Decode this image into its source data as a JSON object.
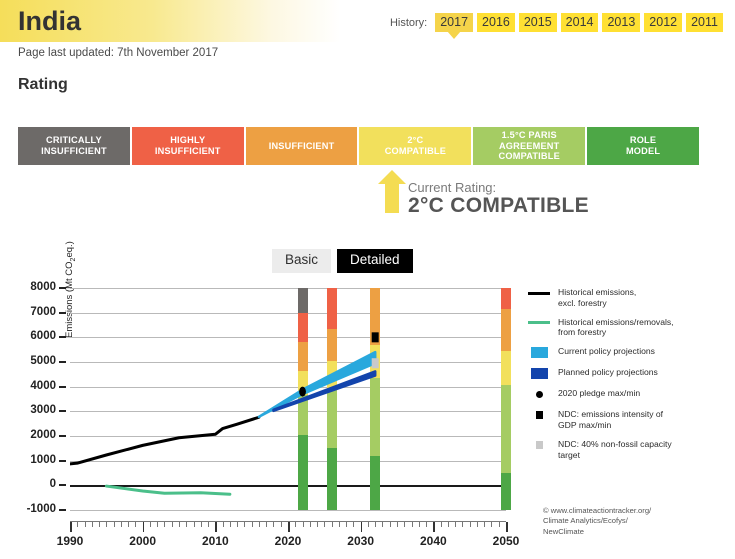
{
  "header": {
    "country_title": "India",
    "page_updated": "Page last updated: 7th November 2017",
    "history_label": "History:",
    "history_years": [
      {
        "year": "2017",
        "active": true
      },
      {
        "year": "2016",
        "active": false
      },
      {
        "year": "2015",
        "active": false
      },
      {
        "year": "2014",
        "active": false
      },
      {
        "year": "2013",
        "active": false
      },
      {
        "year": "2012",
        "active": false
      },
      {
        "year": "2011",
        "active": false
      }
    ]
  },
  "rating": {
    "heading": "Rating",
    "cells": [
      {
        "label": "CRITICALLY\nINSUFFICIENT",
        "color": "#6d6a68"
      },
      {
        "label": "HIGHLY\nINSUFFICIENT",
        "color": "#ef6146"
      },
      {
        "label": "INSUFFICIENT",
        "color": "#eda043"
      },
      {
        "label": "2°C\nCOMPATIBLE",
        "color": "#f2e05c"
      },
      {
        "label": "1.5°C PARIS\nAGREEMENT\nCOMPATIBLE",
        "color": "#a5cc63"
      },
      {
        "label": "ROLE\nMODEL",
        "color": "#4da746"
      }
    ],
    "current_label": "Current Rating:",
    "current_value": "2°C COMPATIBLE",
    "arrow_color": "#f4dc52"
  },
  "toggle": {
    "basic_label": "Basic",
    "detailed_label": "Detailed",
    "active": "Detailed"
  },
  "chart_data": {
    "type": "line",
    "title": "",
    "xlabel": "",
    "ylabel": "Emissions (Mt CO2eq.)",
    "ylabel_prefix": "Emissions (Mt CO",
    "ylabel_sub": "2",
    "ylabel_suffix": "eq.)",
    "xlim": [
      1990,
      2050
    ],
    "ylim": [
      -1000,
      8000
    ],
    "ytick_values": [
      8000,
      7000,
      6000,
      5000,
      4000,
      3000,
      2000,
      1000,
      0,
      -1000
    ],
    "ytick_labels": [
      "8000",
      "7000",
      "6000",
      "5000",
      "4000",
      "3000",
      "2000",
      "1000",
      "0",
      "-1000"
    ],
    "xtick_values": [
      1990,
      2000,
      2010,
      2020,
      2030,
      2040,
      2050
    ],
    "xtick_labels": [
      "1990",
      "2000",
      "2010",
      "2020",
      "2030",
      "2040",
      "2050"
    ],
    "grid": true,
    "series": [
      {
        "name": "Historical emissions, excl. forestry",
        "color": "#000000",
        "type": "line",
        "width": 3,
        "points": [
          [
            1990,
            870
          ],
          [
            1991,
            900
          ],
          [
            1995,
            1230
          ],
          [
            2000,
            1620
          ],
          [
            2005,
            1930
          ],
          [
            2010,
            2070
          ],
          [
            2011,
            2300
          ],
          [
            2013,
            2480
          ],
          [
            2016,
            2760
          ]
        ]
      },
      {
        "name": "Historical emissions/removals, from forestry",
        "color": "#4bbf8a",
        "type": "line",
        "width": 3,
        "points": [
          [
            1995,
            -30
          ],
          [
            2000,
            -230
          ],
          [
            2003,
            -320
          ],
          [
            2008,
            -300
          ],
          [
            2012,
            -360
          ]
        ]
      },
      {
        "name": "Current policy projections",
        "color": "#29a8dd",
        "type": "band",
        "upper": [
          [
            2016,
            2780
          ],
          [
            2022,
            3880
          ],
          [
            2032,
            5400
          ]
        ],
        "lower": [
          [
            2016,
            2780
          ],
          [
            2022,
            3700
          ],
          [
            2032,
            4950
          ]
        ]
      },
      {
        "name": "Planned policy projections",
        "color": "#1344ac",
        "type": "band",
        "upper": [
          [
            2018,
            3060
          ],
          [
            2032,
            4620
          ]
        ],
        "lower": [
          [
            2018,
            3020
          ],
          [
            2032,
            4450
          ]
        ]
      }
    ],
    "markers": [
      {
        "name": "2020 pledge max/min",
        "shape": "dot",
        "color": "#000000",
        "x": 2022,
        "y": 3800
      },
      {
        "name": "NDC: emissions intensity of GDP max/min",
        "shape": "square",
        "color": "#000000",
        "x": 2032,
        "y": 6000
      },
      {
        "name": "NDC: 40% non-fossil capacity target",
        "shape": "square",
        "color": "#c9c9c9",
        "x": 2032,
        "y": 4950
      }
    ],
    "bars": [
      {
        "x": 2022,
        "segments": [
          {
            "color": "#6d6a68",
            "from": 7000,
            "to": 8000
          },
          {
            "color": "#ef6146",
            "from": 5800,
            "to": 7000
          },
          {
            "color": "#eda043",
            "from": 4650,
            "to": 5800
          },
          {
            "color": "#f2e05c",
            "from": 3650,
            "to": 4650
          },
          {
            "color": "#a5cc63",
            "from": 2050,
            "to": 3650
          },
          {
            "color": "#4da746",
            "from": -1000,
            "to": 2050
          }
        ]
      },
      {
        "x": 2026,
        "segments": [
          {
            "color": "#ef6146",
            "from": 6350,
            "to": 8000
          },
          {
            "color": "#eda043",
            "from": 5050,
            "to": 6350
          },
          {
            "color": "#f2e05c",
            "from": 3850,
            "to": 5050
          },
          {
            "color": "#a5cc63",
            "from": 1500,
            "to": 3850
          },
          {
            "color": "#4da746",
            "from": -1000,
            "to": 1500
          }
        ]
      },
      {
        "x": 2032,
        "segments": [
          {
            "color": "#eda043",
            "from": 5700,
            "to": 8000
          },
          {
            "color": "#f2e05c",
            "from": 4350,
            "to": 5700
          },
          {
            "color": "#a5cc63",
            "from": 1200,
            "to": 4350
          },
          {
            "color": "#4da746",
            "from": -1000,
            "to": 1200
          }
        ]
      },
      {
        "x": 2050,
        "segments": [
          {
            "color": "#ef6146",
            "from": 7150,
            "to": 8000
          },
          {
            "color": "#eda043",
            "from": 5450,
            "to": 7150
          },
          {
            "color": "#f2e05c",
            "from": 4050,
            "to": 5450
          },
          {
            "color": "#a5cc63",
            "from": 500,
            "to": 4050
          },
          {
            "color": "#4da746",
            "from": -1000,
            "to": 500
          }
        ]
      }
    ],
    "legend_position": "right",
    "legend": [
      {
        "key": "line",
        "color": "#000000",
        "text": "Historical emissions,\nexcl. forestry"
      },
      {
        "key": "line",
        "color": "#4bbf8a",
        "text": "Historical emissions/removals,\nfrom forestry"
      },
      {
        "key": "swatch",
        "color": "#29a8dd",
        "text": "Current policy projections"
      },
      {
        "key": "swatch",
        "color": "#1344ac",
        "text": "Planned policy projections"
      },
      {
        "key": "dot",
        "color": "#000000",
        "text": "2020 pledge max/min"
      },
      {
        "key": "square",
        "color": "#000000",
        "text": "NDC: emissions intensity of\nGDP max/min"
      },
      {
        "key": "square-gray",
        "color": "#c9c9c9",
        "text": "NDC: 40% non-fossil capacity\ntarget"
      }
    ],
    "credit": "© www.climateactiontracker.org/\n   Climate Analytics/Ecofys/\n   NewClimate"
  }
}
